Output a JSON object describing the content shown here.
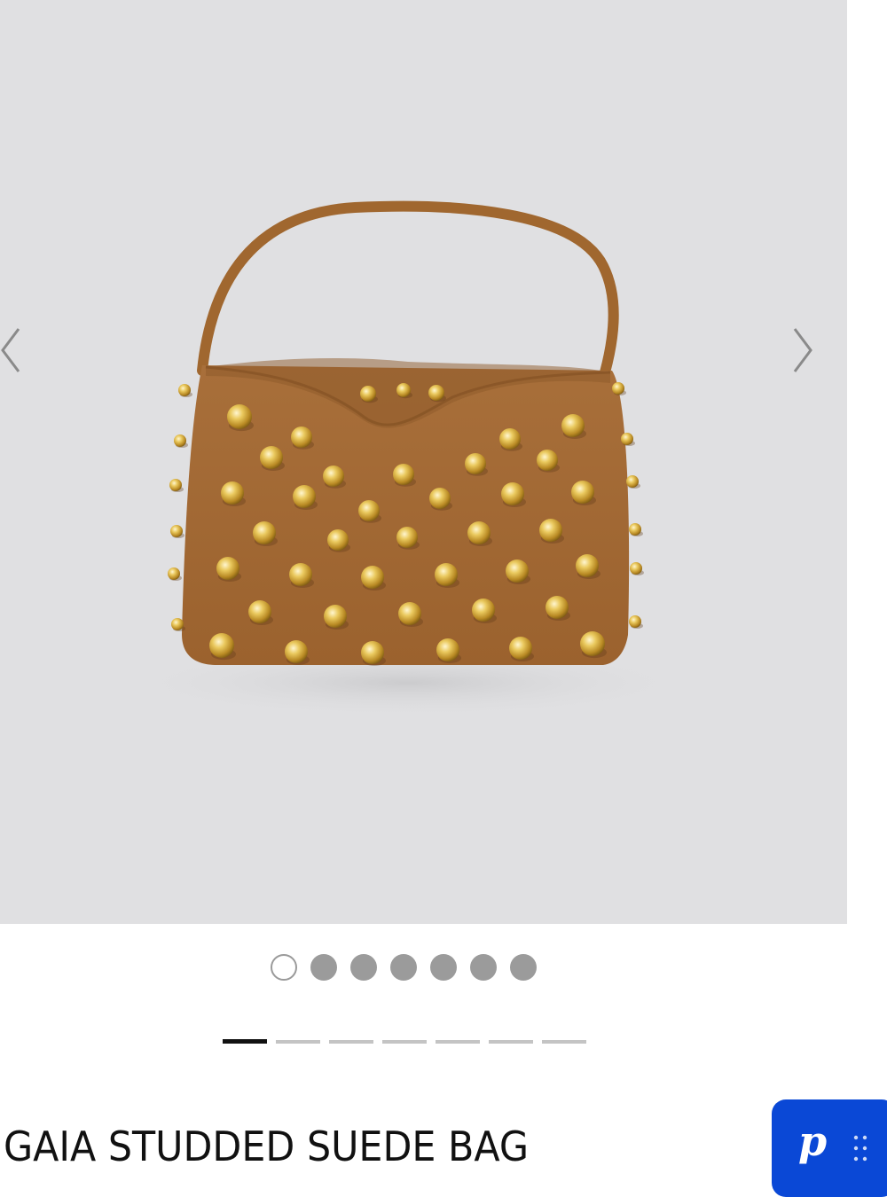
{
  "product": {
    "title": "GAIA STUDDED SUEDE BAG",
    "colors": {
      "suede": "#a56b35",
      "stud": "#e0b33e",
      "background": "#e0e0e2"
    }
  },
  "gallery": {
    "prev_icon": "chevron-left-icon",
    "next_icon": "chevron-right-icon",
    "dots": {
      "total": 7,
      "active_index": 0
    },
    "bars": {
      "total": 7,
      "active_index": 0
    }
  },
  "widget": {
    "letter": "p",
    "icon": "drag-grip-icon",
    "color": "#0a48d6"
  }
}
